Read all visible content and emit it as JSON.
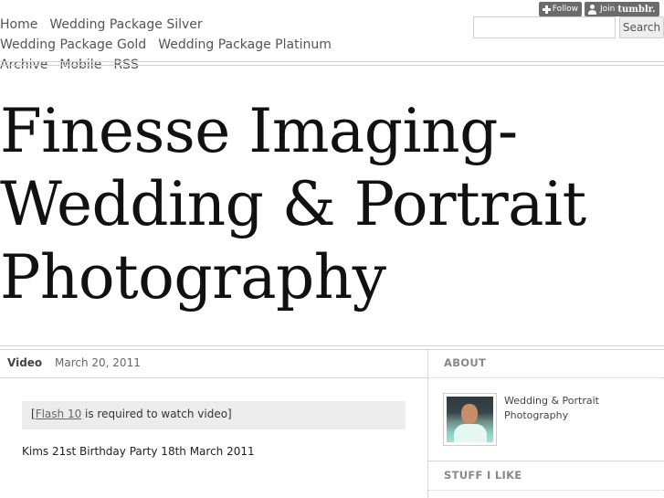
{
  "tumblr": {
    "follow_label": "Follow",
    "join_label": "Join",
    "brand": "tumblr."
  },
  "nav": {
    "items": [
      {
        "label": "Home"
      },
      {
        "label": "Wedding Package Silver"
      },
      {
        "label": "Wedding Package Gold"
      },
      {
        "label": "Wedding Package Platinum"
      },
      {
        "label": "Archive"
      },
      {
        "label": "Mobile"
      },
      {
        "label": "RSS"
      }
    ]
  },
  "search": {
    "value": "",
    "button_label": "Search"
  },
  "site": {
    "title": "Finesse Imaging- Wedding & Portrait Photography"
  },
  "post": {
    "type": "Video",
    "date": "March 20, 2011",
    "flash_prefix": "[",
    "flash_link": "Flash 10",
    "flash_suffix": " is required to watch video]",
    "caption": "Kims 21st Birthday Party 18th March 2011"
  },
  "sidebar": {
    "about_heading": "ABOUT",
    "about_text": "Wedding & Portrait Photography",
    "stuff_heading": "STUFF I LIKE"
  }
}
